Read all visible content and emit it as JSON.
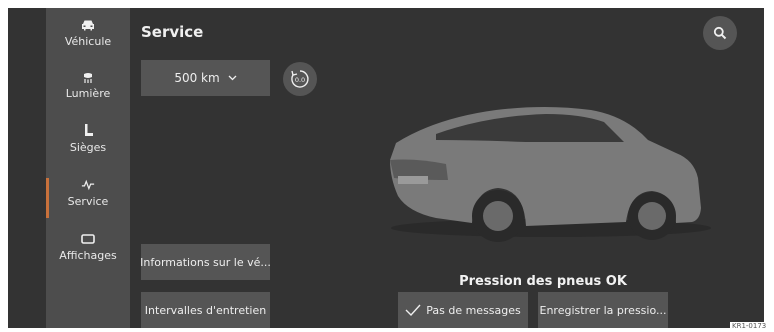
{
  "sidebar": {
    "items": [
      {
        "label": "Véhicule",
        "icon": "car-icon"
      },
      {
        "label": "Lumière",
        "icon": "headlight-icon"
      },
      {
        "label": "Sièges",
        "icon": "seat-icon"
      },
      {
        "label": "Service",
        "icon": "pulse-icon",
        "active": true
      },
      {
        "label": "Affichages",
        "icon": "display-icon"
      }
    ]
  },
  "header": {
    "title": "Service"
  },
  "distance": {
    "value": "500 km"
  },
  "reset": {
    "label": "0.0"
  },
  "buttons": {
    "vehicle_info": "Informations sur le vé...",
    "maintenance": "Intervalles d'entretien",
    "no_messages": "Pas de messages",
    "save_pressure": "Enregistrer la pressio..."
  },
  "tyre_status": "Pression des pneus OK",
  "figure_ref": "KR1-0173",
  "colors": {
    "background": "#333333",
    "sidebar": "#4d4d4d",
    "button": "#555555",
    "accent": "#c9713b"
  }
}
